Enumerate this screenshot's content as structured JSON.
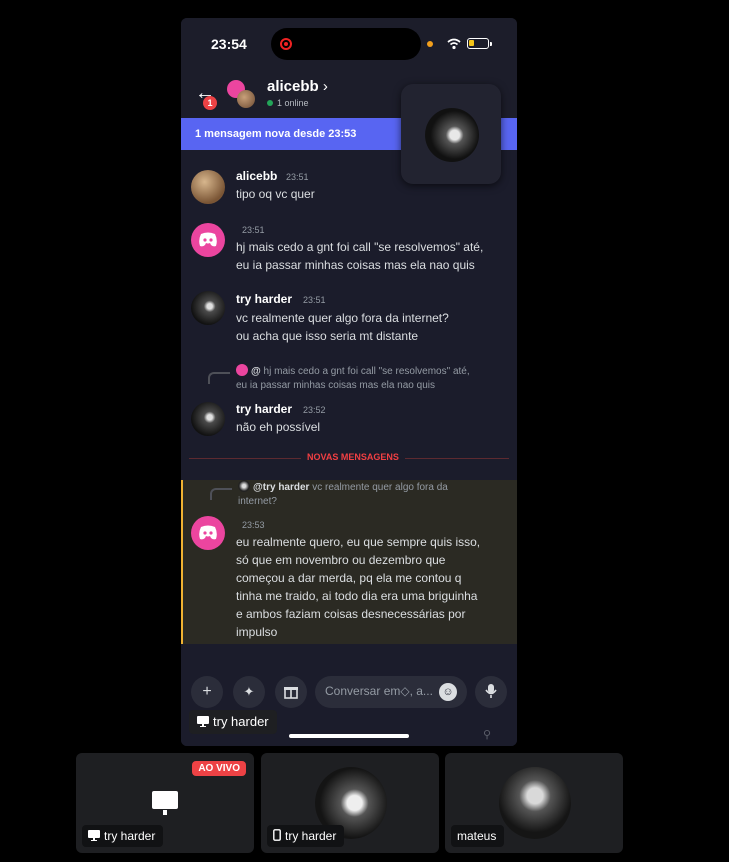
{
  "phone": {
    "time": "23:54",
    "header": {
      "back_badge": "1",
      "name": "alicebb",
      "online": "1 online"
    },
    "banner": "1 mensagem nova desde 23:53",
    "messages": [
      {
        "author": "alicebb",
        "time": "23:51",
        "lines": [
          "tipo oq vc quer"
        ]
      },
      {
        "author": "",
        "time": "23:51",
        "lines": [
          "hj mais cedo a gnt foi call \"se resolvemos\" até,",
          "eu ia passar minhas coisas mas ela nao quis"
        ]
      },
      {
        "author": "try harder",
        "time": "23:51",
        "lines": [
          "vc realmente quer algo fora da internet?",
          "ou acha que isso seria mt distante"
        ]
      },
      {
        "reply_prefix": "@",
        "reply_text": "hj mais cedo a gnt foi call \"se resolvemos\" até,",
        "reply_text2": "eu ia passar minhas coisas mas ela nao quis",
        "author": "try harder",
        "time": "23:52",
        "lines": [
          "não eh possível"
        ]
      },
      {
        "reply_prefix": "@try harder",
        "reply_text": "vc realmente quer algo fora da",
        "reply_text2": "internet?",
        "author": "",
        "time": "23:53",
        "lines": [
          "eu realmente quero, eu que sempre quis isso,",
          "só que em novembro ou dezembro que",
          "começou a dar merda, pq ela me contou q",
          "tinha me traido, ai todo dia era uma briguinha",
          "e ambos faziam coisas desnecessárias por",
          "impulso"
        ]
      }
    ],
    "divider": "NOVAS MENSAGENS",
    "composer": {
      "placeholder": "Conversar em◇, a..."
    },
    "share_label": "try harder"
  },
  "tiles": [
    {
      "label": "try harder",
      "badge": "AO VIVO"
    },
    {
      "label": "try harder"
    },
    {
      "label": "mateus"
    }
  ],
  "colors": {
    "blurple": "#5865f2",
    "live_red": "#ed4245",
    "discord_pink": "#eb459f",
    "online_green": "#23a559",
    "highlight_gold": "#f0b232"
  }
}
